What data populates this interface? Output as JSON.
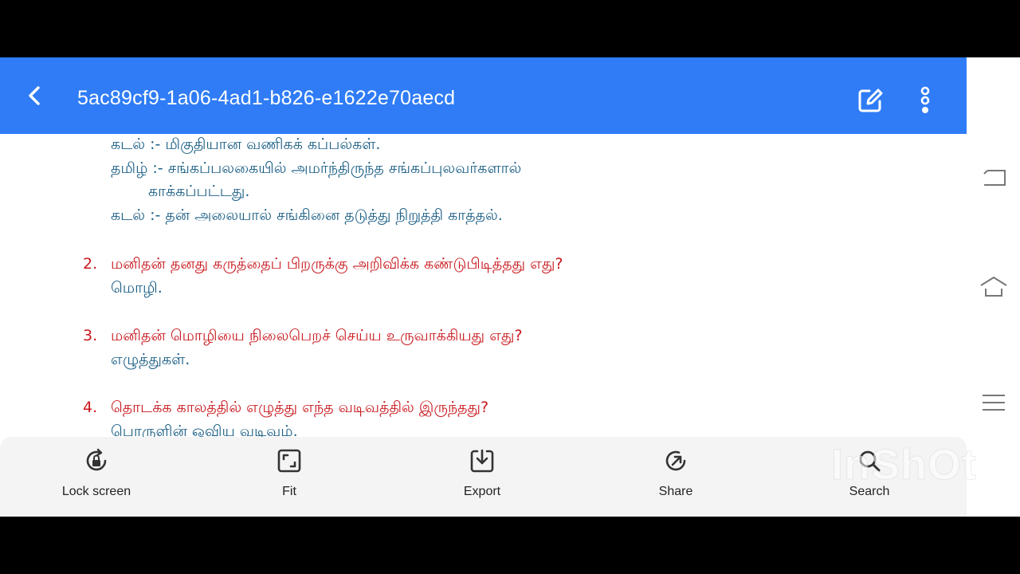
{
  "header": {
    "title": "5ac89cf9-1a06-4ad1-b826-e1622e70aecd",
    "back_icon": "chevron-left-icon",
    "edit_icon": "edit-icon",
    "more_icon": "more-vertical-icon",
    "color": "#2f7cf6"
  },
  "document": {
    "answer_lines": [
      "கடல் :- மிகுதியான வணிகக் கப்பல்கள்.",
      "தமிழ் :- சங்கப்பலகையில் அமர்ந்திருந்த சங்கப்புலவர்களால்",
      "காக்கப்பட்டது.",
      "கடல் :- தன் அலையால் சங்கினை தடுத்து நிறுத்தி காத்தல்."
    ],
    "questions": [
      {
        "number": "2.",
        "question": "மனிதன் தனது கருத்தைப் பிறருக்கு அறிவிக்க கண்டுபிடித்தது எது?",
        "answer": "மொழி."
      },
      {
        "number": "3.",
        "question": "மனிதன் மொழியை நிலைபெறச் செய்ய உருவாக்கியது எது?",
        "answer": "எழுத்துகள்."
      },
      {
        "number": "4.",
        "question": "தொடக்க காலத்தில் எழுத்து எந்த வடிவத்தில் இருந்தது?",
        "answer": "பொருளின் ஓவிய வடிவம்."
      }
    ],
    "question_color": "#c8191e",
    "answer_color": "#1c5f86"
  },
  "toolbar": {
    "items": [
      {
        "label": "Lock screen",
        "icon": "lock-rotation-icon"
      },
      {
        "label": "Fit",
        "icon": "fit-screen-icon"
      },
      {
        "label": "Export",
        "icon": "export-icon"
      },
      {
        "label": "Share",
        "icon": "share-icon"
      },
      {
        "label": "Search",
        "icon": "search-icon"
      }
    ]
  },
  "system_nav": {
    "buttons": [
      "back-nav-icon",
      "home-nav-icon",
      "recents-nav-icon"
    ]
  },
  "watermark": "InShOt"
}
